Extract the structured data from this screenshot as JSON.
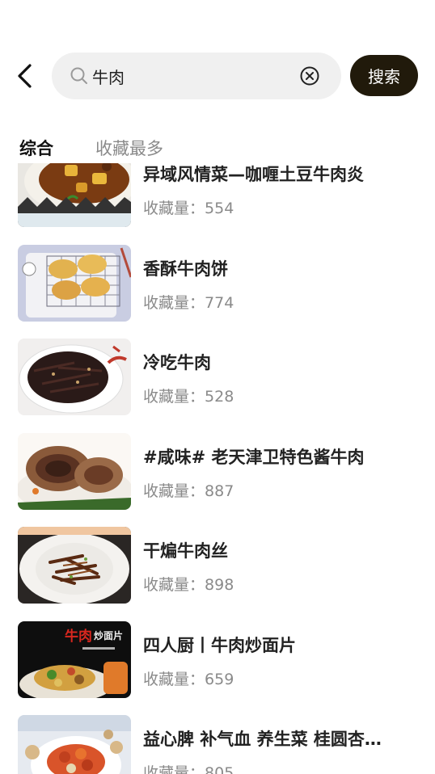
{
  "search": {
    "query": "牛肉",
    "button_label": "搜索"
  },
  "tabs": [
    {
      "label": "综合",
      "active": true
    },
    {
      "label": "收藏最多",
      "active": false
    }
  ],
  "results": [
    {
      "title": "异域风情菜—咖喱土豆牛肉炎",
      "count_label": "收藏量：",
      "count": "554"
    },
    {
      "title": "香酥牛肉饼",
      "count_label": "收藏量：",
      "count": "774"
    },
    {
      "title": "冷吃牛肉",
      "count_label": "收藏量：",
      "count": "528"
    },
    {
      "title": "#咸味#  老天津卫特色酱牛肉",
      "count_label": "收藏量：",
      "count": "887"
    },
    {
      "title": "干煸牛肉丝",
      "count_label": "收藏量：",
      "count": "898"
    },
    {
      "title": "四人厨丨牛肉炒面片",
      "count_label": "收藏量：",
      "count": "659",
      "thumb_text": "牛肉",
      "thumb_text2": "炒面片"
    },
    {
      "title": "益心脾 补气血 养生菜 桂圆杏…",
      "count_label": "收藏量：",
      "count": "805"
    }
  ],
  "colors": {
    "search_button_bg": "#211a0b",
    "search_box_bg": "#f0f0f0",
    "muted_text": "#8a8a8a"
  }
}
